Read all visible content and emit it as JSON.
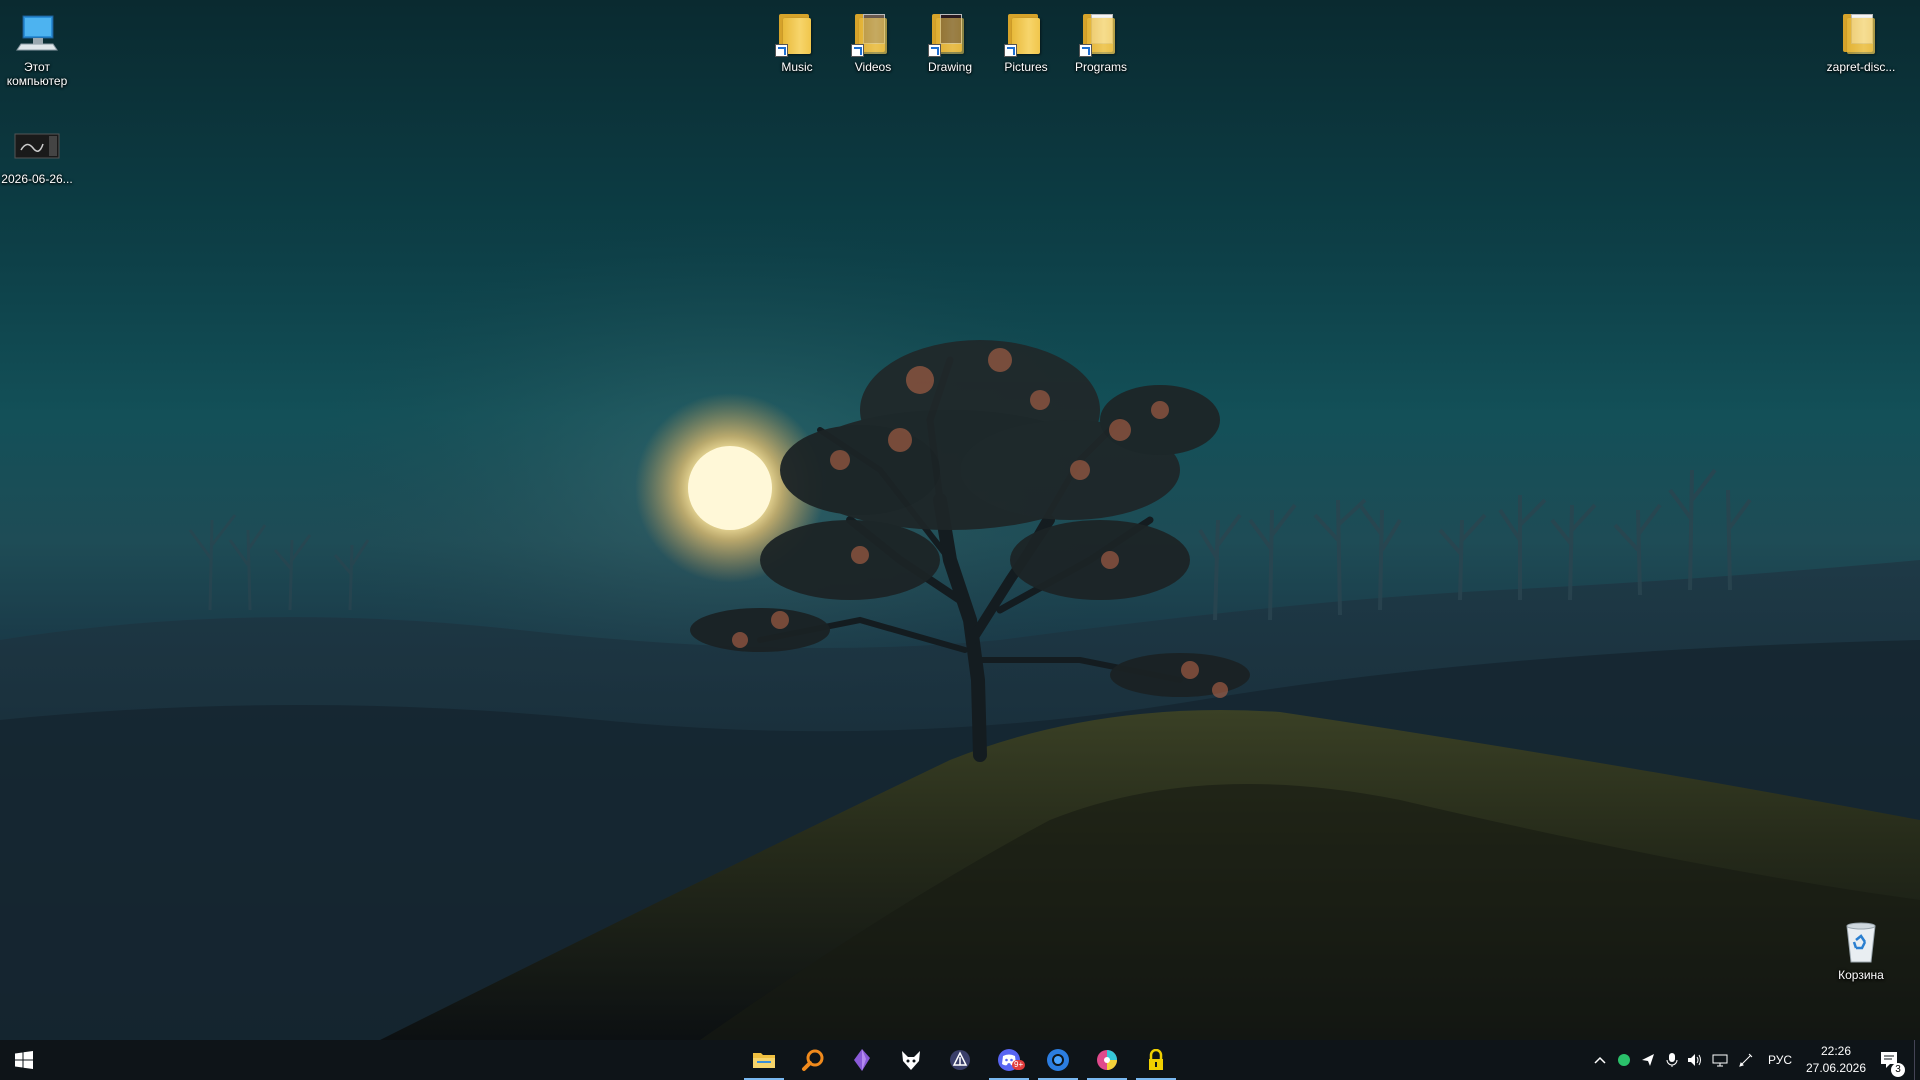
{
  "desktop_icons": {
    "this_pc": "Этот компьютер",
    "screenshot_file": "2026-06-26...",
    "music": "Music",
    "videos": "Videos",
    "drawing": "Drawing",
    "pictures": "Pictures",
    "programs": "Programs",
    "zapret": "zapret-disc...",
    "recycle_bin": "Корзина"
  },
  "taskbar": {
    "apps": [
      {
        "name": "file-explorer",
        "icon": "folder-icon",
        "active": true
      },
      {
        "name": "search-app",
        "icon": "magnifier-icon",
        "active": false
      },
      {
        "name": "purple-gem-app",
        "icon": "gem-icon",
        "active": false
      },
      {
        "name": "fox-app",
        "icon": "fox-icon",
        "active": false
      },
      {
        "name": "triangle-app",
        "icon": "triangle-icon",
        "active": false
      },
      {
        "name": "discord",
        "icon": "discord-icon",
        "active": true,
        "badge": "9+"
      },
      {
        "name": "browser",
        "icon": "browser-icon",
        "active": true
      },
      {
        "name": "color-app",
        "icon": "palette-icon",
        "active": true
      },
      {
        "name": "lock-app",
        "icon": "padlock-icon",
        "active": true
      }
    ],
    "tray": {
      "language": "РУС",
      "time": "22:26",
      "date": "27.06.2026",
      "notification_count": "3"
    }
  },
  "colors": {
    "taskbar_bg": "#0e1418",
    "active_indicator": "#79b8f0",
    "sun": "#fff7d0"
  }
}
